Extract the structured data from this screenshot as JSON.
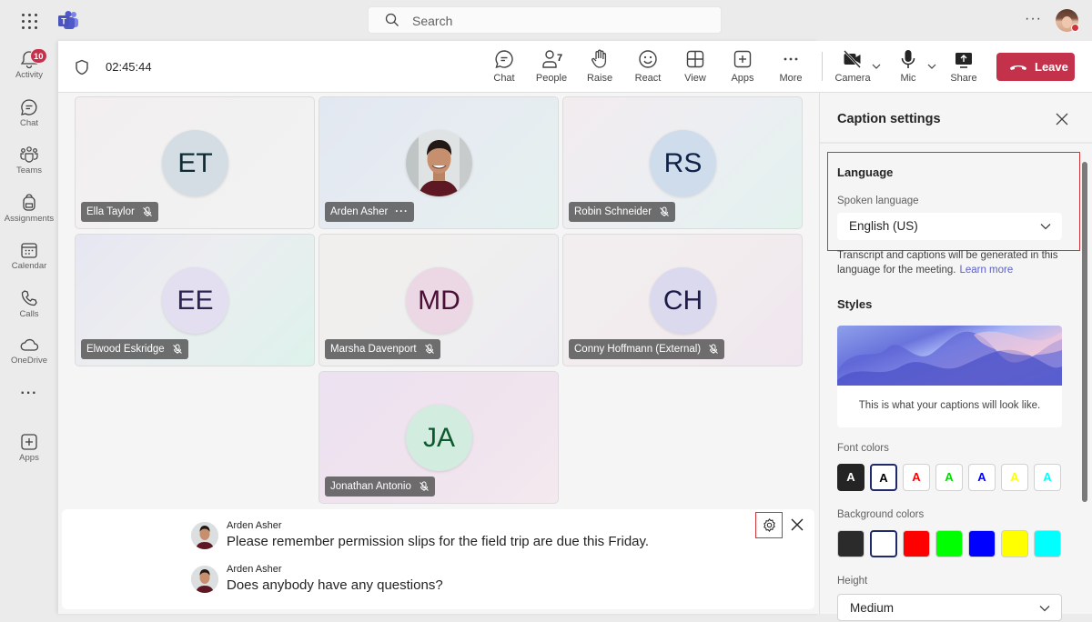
{
  "topbar": {
    "search_placeholder": "Search",
    "more_label": "···"
  },
  "rail": {
    "items": [
      {
        "label": "Activity",
        "icon": "bell-icon",
        "badge": "10"
      },
      {
        "label": "Chat",
        "icon": "chat-icon"
      },
      {
        "label": "Teams",
        "icon": "teams-icon"
      },
      {
        "label": "Assignments",
        "icon": "backpack-icon"
      },
      {
        "label": "Calendar",
        "icon": "calendar-icon"
      },
      {
        "label": "Calls",
        "icon": "phone-icon"
      },
      {
        "label": "OneDrive",
        "icon": "cloud-icon"
      },
      {
        "label": "···",
        "icon": "more-icon"
      },
      {
        "label": "Apps",
        "icon": "add-app-icon"
      }
    ]
  },
  "meeting": {
    "timer": "02:45:44",
    "toolbar": {
      "chat": "Chat",
      "people": "People",
      "people_count": "7",
      "raise": "Raise",
      "react": "React",
      "view": "View",
      "apps": "Apps",
      "more": "More",
      "camera": "Camera",
      "mic": "Mic",
      "share": "Share",
      "leave": "Leave"
    },
    "participants": [
      {
        "initials": "ET",
        "name": "Ella Taylor",
        "muted": true,
        "avatar_bg": "#d3dde3",
        "avatar_fg": "#0f2a33"
      },
      {
        "initials": "",
        "name": "Arden Asher",
        "muted": false,
        "photo": true,
        "more": "···"
      },
      {
        "initials": "RS",
        "name": "Robin Schneider",
        "muted": true,
        "avatar_bg": "#cfdcec",
        "avatar_fg": "#0f2346"
      },
      {
        "initials": "EE",
        "name": "Elwood Eskridge",
        "muted": true,
        "avatar_bg": "#e3def0",
        "avatar_fg": "#2b2450"
      },
      {
        "initials": "MD",
        "name": "Marsha Davenport",
        "muted": true,
        "avatar_bg": "#ecd7e4",
        "avatar_fg": "#4a0f35"
      },
      {
        "initials": "CH",
        "name": "Conny Hoffmann (External)",
        "muted": true,
        "avatar_bg": "#dbd9ee",
        "avatar_fg": "#1c1b4a"
      },
      {
        "initials": "JA",
        "name": "Jonathan Antonio",
        "muted": true,
        "avatar_bg": "#d3ece0",
        "avatar_fg": "#0e5a2e"
      }
    ],
    "captions": [
      {
        "speaker": "Arden Asher",
        "text": "Please remember permission slips for the field trip are due this Friday."
      },
      {
        "speaker": "Arden Asher",
        "text": "Does anybody have any questions?"
      }
    ]
  },
  "caption_settings": {
    "title": "Caption settings",
    "language_heading": "Language",
    "spoken_language_label": "Spoken language",
    "spoken_language_value": "English (US)",
    "help_text": "Transcript and captions will be generated in this language for the meeting.",
    "learn_more": "Learn more",
    "styles_heading": "Styles",
    "preview_text": "This is what your captions will look like.",
    "font_colors_label": "Font colors",
    "font_colors": [
      {
        "glyph": "A",
        "color": "#ffffff",
        "bg": "#242424",
        "selected": false
      },
      {
        "glyph": "A",
        "color": "#000000",
        "bg": "#ffffff",
        "selected": true
      },
      {
        "glyph": "A",
        "color": "#ff0000",
        "bg": "#ffffff",
        "selected": false
      },
      {
        "glyph": "A",
        "color": "#00dd00",
        "bg": "#ffffff",
        "selected": false
      },
      {
        "glyph": "A",
        "color": "#0000ff",
        "bg": "#ffffff",
        "selected": false
      },
      {
        "glyph": "A",
        "color": "#ffff00",
        "bg": "#ffffff",
        "selected": false
      },
      {
        "glyph": "A",
        "color": "#00ffff",
        "bg": "#ffffff",
        "selected": false
      }
    ],
    "background_colors_label": "Background colors",
    "background_colors": [
      {
        "color": "#2b2b2b",
        "selected": false
      },
      {
        "color": "#ffffff",
        "selected": true
      },
      {
        "color": "#ff0000",
        "selected": false
      },
      {
        "color": "#00ff00",
        "selected": false
      },
      {
        "color": "#0000ff",
        "selected": false
      },
      {
        "color": "#ffff00",
        "selected": false
      },
      {
        "color": "#00ffff",
        "selected": false
      }
    ],
    "height_label": "Height",
    "height_value": "Medium"
  },
  "colors": {
    "leave": "#c4314b",
    "highlight": "#d13438",
    "link": "#5b5fc7"
  }
}
